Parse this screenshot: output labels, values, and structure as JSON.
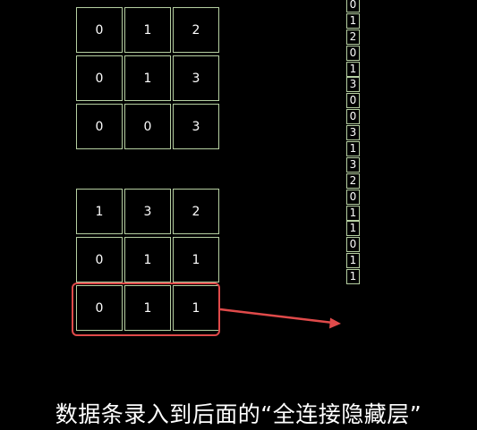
{
  "top_matrix": [
    [
      "0",
      "1",
      "2"
    ],
    [
      "0",
      "1",
      "3"
    ],
    [
      "0",
      "0",
      "3"
    ]
  ],
  "bottom_matrix": [
    [
      "1",
      "3",
      "2"
    ],
    [
      "0",
      "1",
      "1"
    ],
    [
      "0",
      "1",
      "1"
    ]
  ],
  "vector": [
    "0",
    "1",
    "2",
    "0",
    "1",
    "3",
    "0",
    "0",
    "3",
    "1",
    "3",
    "2",
    "0",
    "1",
    "1",
    "0",
    "1",
    "1"
  ],
  "caption": "数据条录入到后面的“全连接隐藏层”",
  "colors": {
    "background": "#000000",
    "cell_border": "#b6d0a2",
    "highlight": "#e04a4a",
    "text": "#ffffff"
  }
}
